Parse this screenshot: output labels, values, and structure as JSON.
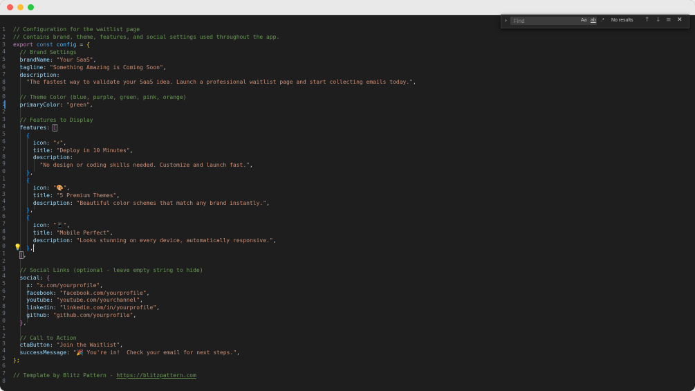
{
  "find": {
    "placeholder": "Find",
    "match_case_label": "Aa",
    "whole_word_label": "ab",
    "regex_label": ".*",
    "results": "No results",
    "prev_icon": "arrow-up",
    "next_icon": "arrow-down",
    "selection_icon": "find-in-selection",
    "close_icon": "close"
  },
  "code": {
    "l1": "// Configuration for the waitlist page",
    "l2": "// Contains brand, theme, features, and social settings used throughout the app.",
    "l3_export": "export",
    "l3_const": "const",
    "l3_name": "config",
    "l3_eq": " = ",
    "l3_brace": "{",
    "l4": "// Brand Settings",
    "l5_key": "brandName",
    "l5_val": "\"Your SaaS\"",
    "l6_key": "tagline",
    "l6_val": "\"Something Amazing is Coming Soon\"",
    "l7_key": "description",
    "l8_val": "\"The fastest way to validate your SaaS idea. Launch a professional waitlist page and start collecting emails today.\"",
    "l10": "// Theme Color (blue, purple, green, pink, orange)",
    "l11_key": "primaryColor",
    "l11_val": "\"green\"",
    "l13": "// Features to Display",
    "l14_key": "features",
    "open_square": "[",
    "close_square": "]",
    "open_curly": "{",
    "close_curly": "}",
    "key_icon": "icon",
    "key_title": "title",
    "key_description": "description",
    "f1_icon": "\"⚡\"",
    "f1_title": "\"Deploy in 10 Minutes\"",
    "f1_desc": "\"No design or coding skills needed. Customize and launch fast.\"",
    "f2_icon": "\"🎨\"",
    "f2_title": "\"5 Premium Themes\"",
    "f2_desc": "\"Beautiful color schemes that match any brand instantly.\"",
    "f3_icon": "\"📱\"",
    "f3_title": "\"Mobile Perfect\"",
    "f3_desc": "\"Looks stunning on every device, automatically responsive.\"",
    "l36": "// Social Links (optional - leave empty string to hide)",
    "l37_key": "social",
    "s_x_key": "x",
    "s_x_val": "\"x.com/yourprofile\"",
    "s_fb_key": "facebook",
    "s_fb_val": "\"facebook.com/yourprofile\"",
    "s_yt_key": "youtube",
    "s_yt_val": "\"youtube.com/yourchannel\"",
    "s_li_key": "linkedin",
    "s_li_val": "\"linkedin.com/in/yourprofile\"",
    "s_gh_key": "github",
    "s_gh_val": "\"github.com/yourprofile\"",
    "l45": "// Call to Action",
    "cta_key": "ctaButton",
    "cta_val": "\"Join the Waitlist\"",
    "success_key": "successMessage",
    "success_val": "\"🎉 You're in!  Check your email for next steps.\"",
    "end": "};",
    "footer_prefix": "// Template by Blitz Pattern - ",
    "footer_url": "https://blitzpattern.com",
    "colon": ": ",
    "comma": ","
  }
}
